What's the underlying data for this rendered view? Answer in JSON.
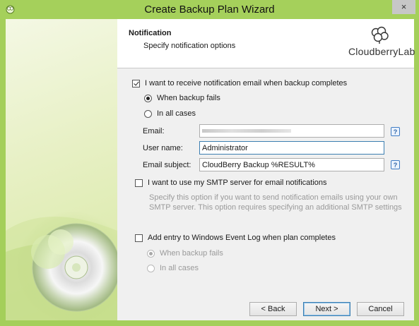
{
  "window": {
    "title": "Create Backup Plan Wizard",
    "close_glyph": "×"
  },
  "header": {
    "title": "Notification",
    "subtitle": "Specify notification options",
    "logo_text": "CloudberryLab",
    "logo_icon": "cloudberry-logo-icon"
  },
  "notify": {
    "checkbox_label": "I want to receive notification email when backup completes",
    "checked": true,
    "radio_fails": "When backup fails",
    "radio_all": "In all cases",
    "selected": "fails"
  },
  "fields": {
    "email_label": "Email:",
    "email_value": "",
    "username_label": "User name:",
    "username_value": "Administrator",
    "subject_label": "Email subject:",
    "subject_value": "CloudBerry Backup %RESULT%",
    "help_glyph": "?"
  },
  "smtp": {
    "checkbox_label": "I want to use my SMTP server for email notifications",
    "checked": false,
    "description_line1": "Specify this option if you want to send notification emails using your own",
    "description_line2": "SMTP server. This option requires specifying an additional SMTP settings"
  },
  "eventlog": {
    "checkbox_label": "Add entry to Windows Event Log when plan completes",
    "checked": false,
    "radio_fails": "When backup fails",
    "radio_all": "In all cases"
  },
  "buttons": {
    "back": "< Back",
    "next": "Next >",
    "cancel": "Cancel"
  },
  "colors": {
    "accent": "#a5d05b",
    "focus_border": "#3c7fb1"
  }
}
